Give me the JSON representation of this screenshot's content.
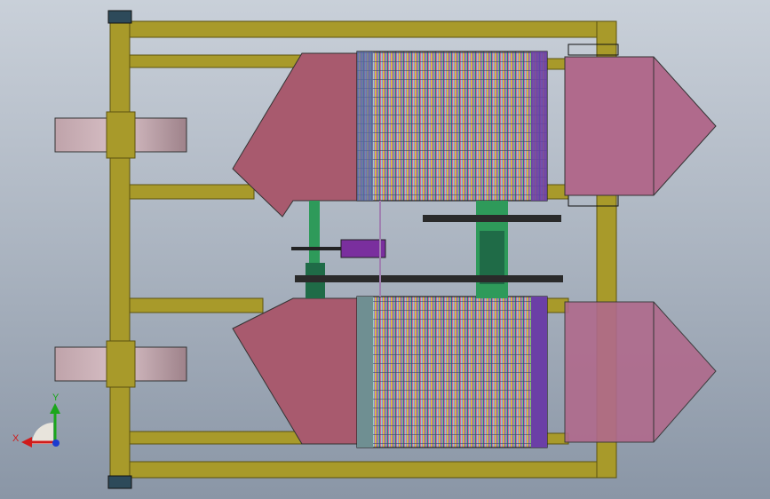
{
  "colors": {
    "frame": "#a89a2a",
    "frame_dark": "#5c5310",
    "cone": "#a85a6e",
    "cone_outlet": "#b06a8c",
    "wheel": "#c8a9b1",
    "shaft": "#2e9a5a",
    "shaft_dark": "#1f6b47",
    "drum_left_end": "#6f8f92",
    "drum_right_end": "#6b3fa6",
    "handle": "#7a2f9e",
    "gear": "#2a2a2a"
  },
  "triad": {
    "x_label": "X",
    "y_label": "Y",
    "x_color": "#d01b1b",
    "y_color": "#1ba61b",
    "z_color": "#1b3bd0"
  }
}
